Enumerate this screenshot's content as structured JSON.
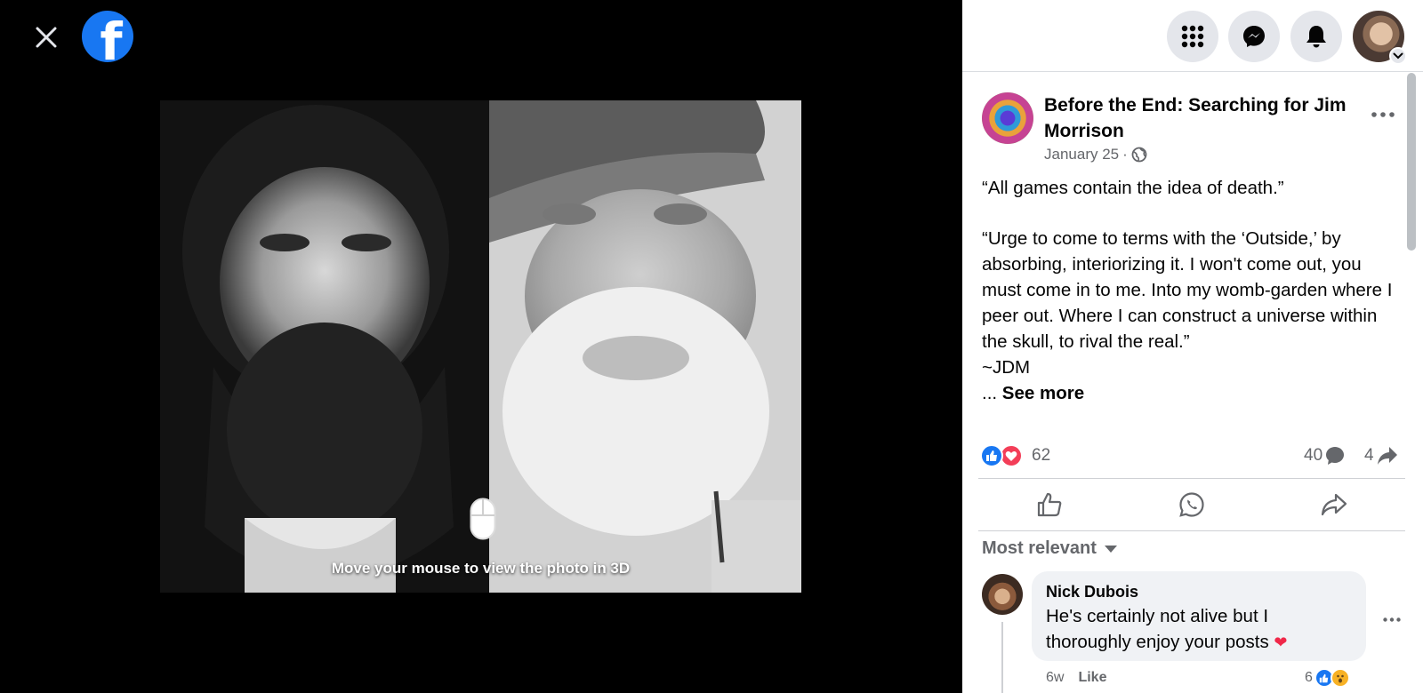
{
  "viewer": {
    "close_icon": "close-icon",
    "logo_glyph": "f",
    "hint": "Move your mouse to view the photo in 3D"
  },
  "topbar": {
    "icons": [
      "menu-grid-icon",
      "messenger-icon",
      "notifications-bell-icon",
      "account-caret-icon"
    ]
  },
  "post": {
    "title": "Before the End: Searching for Jim Morrison",
    "date": "January 25",
    "separator": "·",
    "privacy_icon": "globe-icon",
    "body_p1": "“All games contain the idea of death.”",
    "body_p2": "“Urge to come to terms with the ‘Outside,’ by absorbing, interiorizing it. I won't come out, you must come in to me. Into my womb-garden where I peer out. Where I can construct a universe within the skull, to rival the real.”",
    "body_p3": "~JDM",
    "ellipsis": "... ",
    "see_more": "See more"
  },
  "stats": {
    "reactions": "62",
    "comments": "40",
    "shares": "4"
  },
  "actions": {
    "icons": [
      "like-thumb-icon",
      "whatsapp-icon",
      "share-arrow-icon"
    ]
  },
  "comments": {
    "sort_label": "Most relevant",
    "items": [
      {
        "author": "Nick Dubois",
        "text": "He's certainly not alive but I thoroughly enjoy your posts",
        "emoji": "❤",
        "time": "6w",
        "like_label": "Like",
        "reaction_count": "6"
      }
    ]
  },
  "colors": {
    "brand": "#1877F2",
    "love": "#f33e58",
    "muted_text": "#65676b"
  }
}
